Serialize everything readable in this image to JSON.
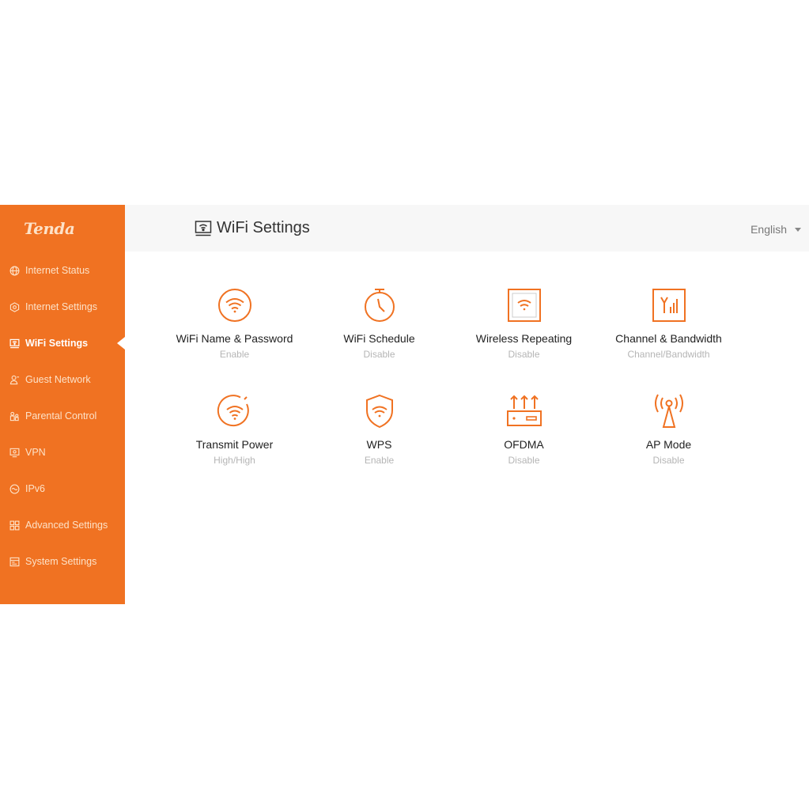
{
  "brand": {
    "logo_text": "Tenda",
    "accent": "#f07222"
  },
  "sidebar": {
    "items": [
      {
        "label": "Internet Status",
        "icon": "globe-icon"
      },
      {
        "label": "Internet Settings",
        "icon": "hexagon-icon"
      },
      {
        "label": "WiFi Settings",
        "icon": "wifi-monitor-icon",
        "active": true
      },
      {
        "label": "Guest Network",
        "icon": "guest-icon"
      },
      {
        "label": "Parental Control",
        "icon": "parental-icon"
      },
      {
        "label": "VPN",
        "icon": "vpn-monitor-icon"
      },
      {
        "label": "IPv6",
        "icon": "ipv6-icon"
      },
      {
        "label": "Advanced Settings",
        "icon": "grid-icon"
      },
      {
        "label": "System Settings",
        "icon": "system-icon"
      }
    ]
  },
  "header": {
    "title": "WiFi Settings",
    "title_icon": "wifi-monitor-icon",
    "language": "English"
  },
  "tiles": [
    {
      "label": "WiFi Name & Password",
      "status": "Enable",
      "icon": "wifi-circle-icon"
    },
    {
      "label": "WiFi Schedule",
      "status": "Disable",
      "icon": "stopwatch-icon"
    },
    {
      "label": "Wireless Repeating",
      "status": "Disable",
      "icon": "repeater-icon"
    },
    {
      "label": "Channel & Bandwidth",
      "status": "Channel/Bandwidth",
      "icon": "channel-icon"
    },
    {
      "label": "Transmit Power",
      "status": "High/High",
      "icon": "transmit-power-icon"
    },
    {
      "label": "WPS",
      "status": "Enable",
      "icon": "wps-shield-icon"
    },
    {
      "label": "OFDMA",
      "status": "Disable",
      "icon": "router-icon"
    },
    {
      "label": "AP Mode",
      "status": "Disable",
      "icon": "antenna-icon"
    }
  ]
}
